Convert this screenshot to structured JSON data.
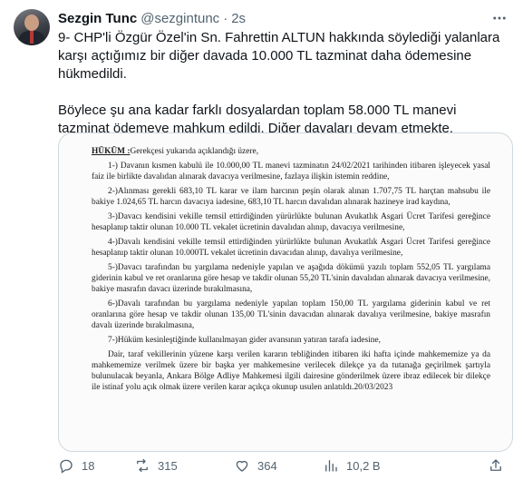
{
  "tweet": {
    "name": "Sezgin Tunc",
    "handle": "@sezgintunc",
    "dot": "·",
    "time": "2s",
    "text": "9- CHP'li Özgür Özel'in Sn. Fahrettin ALTUN hakkında söylediği yalanlara karşı açtığımız bir diğer davada 10.000 TL tazminat daha ödemesine hükmedildi.\n\nBöylece şu ana kadar farklı dosyalardan toplam 58.000 TL manevi tazminat ödemeye mahkum edildi. Diğer davaları devam etmekte."
  },
  "document": {
    "heading_label": "HÜKÜM :",
    "heading_rest": "Gerekçesi yukarıda açıklandığı üzere,",
    "paragraphs": [
      "1-) Davanın kısmen kabulü ile 10.000,00 TL manevi tazminatın 24/02/2021 tarihinden itibaren işleyecek yasal faiz ile birlikte davalıdan alınarak davacıya verilmesine, fazlaya ilişkin istemin reddine,",
      "2-)Alınması gerekli 683,10 TL karar ve ilam harcının peşin olarak alınan 1.707,75 TL harçtan mahsubu ile bakiye 1.024,65 TL harcın davacıya iadesine, 683,10 TL harcın davalıdan alınarak hazineye irad kaydına,",
      "3-)Davacı kendisini vekille temsil ettirdiğinden yürürlükte bulunan Avukatlık Asgari Ücret Tarifesi gereğince hesaplanıp taktir olunan 10.000 TL vekalet ücretinin davalıdan alınıp, davacıya verilmesine,",
      "4-)Davalı kendisini vekille temsil ettirdiğinden yürürlükte bulunan Avukatlık Asgari Ücret Tarifesi gereğince hesaplanıp taktir olunan 10.000TL vekalet ücretinin davacıdan alınıp, davalıya verilmesine,",
      "5-)Davacı tarafından bu yargılama nedeniyle yapılan ve aşağıda dökümü yazılı toplam 552,05 TL yargılama giderinin kabul ve ret oranlarına göre hesap ve takdir olunan 55,20 TL'sinin davalıdan alınarak davacıya verilmesine, bakiye masrafın davacı üzerinde bırakılmasına,",
      "6-)Davalı tarafından bu yargılama nedeniyle yapılan toplam 150,00 TL yargılama giderinin kabul ve ret oranlarına göre hesap ve takdir olunan 135,00 TL'sinin davacıdan alınarak davalıya verilmesine, bakiye masrafın davalı üzerinde bırakılmasına,",
      "7-)Hüküm kesinleştiğinde kullanılmayan gider avansının yatıran tarafa iadesine,",
      "Dair, taraf vekillerinin yüzene karşı verilen kararın tebliğinden itibaren iki hafta içinde mahkememize ya da mahkememize verilmek üzere bir başka yer mahkemesine verilecek dilekçe ya da tutanağa geçirilmek şartıyla bulunulacak beyanla, Ankara Bölge Adliye Mahkemesi ilgili dairesine gönderilmek üzere ibraz edilecek bir dilekçe ile istinaf yolu açık olmak üzere verilen karar açıkça okunup usulen anlatıldı.20/03/2023"
    ]
  },
  "actions": {
    "replies": "18",
    "retweets": "315",
    "likes": "364",
    "views": "10,2 B"
  }
}
